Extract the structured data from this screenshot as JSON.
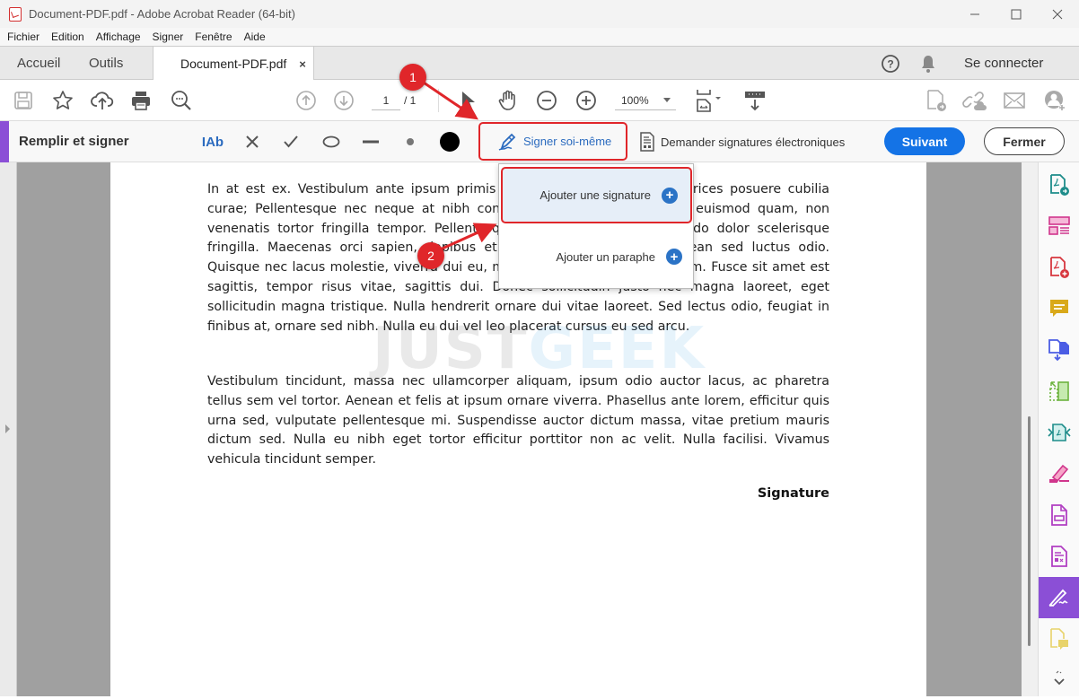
{
  "window": {
    "title": "Document-PDF.pdf - Adobe Acrobat Reader (64-bit)",
    "controls": [
      "minimize",
      "maximize",
      "close"
    ]
  },
  "menu": [
    "Fichier",
    "Edition",
    "Affichage",
    "Signer",
    "Fenêtre",
    "Aide"
  ],
  "tabs": {
    "home": "Accueil",
    "tools": "Outils",
    "document": "Document-PDF.pdf",
    "close_glyph": "×",
    "signin": "Se connecter"
  },
  "toolbar": {
    "page_current": "1",
    "page_total": "/ 1",
    "zoom": "100%"
  },
  "signbar": {
    "title": "Remplir et signer",
    "text_tool": "IAb",
    "sign_self": "Signer soi-même",
    "request_signatures": "Demander signatures électroniques",
    "next": "Suivant",
    "close": "Fermer"
  },
  "dropdown": {
    "items": [
      {
        "label": "Ajouter une signature",
        "icon": "plus-circle-icon"
      },
      {
        "label": "Ajouter un paraphe",
        "icon": "plus-circle-icon"
      }
    ]
  },
  "document": {
    "paragraphs": [
      "In at est ex. Vestibulum ante ipsum primis in faucibus orci luctus et ultrices posuere cubilia curae; Pellentesque nec neque at nibh congue viverra. Donec volutpat euismod quam, non venenatis tortor fringilla tempor. Pellentesque habitant amet, a commodo dolor scelerisque fringilla. Maecenas orci sapien, dapibus et dapibus maximus nisl. Aenean sed luctus odio. Quisque nec lacus molestie, viverra dui eu, maximus orci. In id lectus ipsum. Fusce sit amet est sagittis, tempor risus vitae, sagittis dui. Donec sollicitudin justo nec magna laoreet, eget sollicitudin magna tristique. Nulla hendrerit ornare dui vitae laoreet. Sed lectus odio, feugiat in finibus at, ornare sed nibh. Nulla eu dui vel leo placerat cursus eu sed arcu.",
      "Vestibulum tincidunt, massa nec ullamcorper aliquam, ipsum odio auctor lacus, ac pharetra tellus sem vel tortor. Aenean et felis at ipsum ornare viverra. Phasellus ante lorem, efficitur quis urna sed, vulputate pellentesque mi. Suspendisse auctor dictum massa, vitae pretium mauris dictum sed. Nulla eu nibh eget tortor efficitur porttitor non ac velit. Nulla facilisi. Vivamus vehicula tincidunt semper."
    ],
    "signature_label": "Signature"
  },
  "watermark": {
    "part1": "JUST",
    "part2": "GEEK"
  },
  "annotations": {
    "marker1": "1",
    "marker2": "2"
  },
  "colors": {
    "accent_purple": "#8b4fd6",
    "primary_blue": "#1473e6",
    "highlight_red": "#e0262a"
  }
}
